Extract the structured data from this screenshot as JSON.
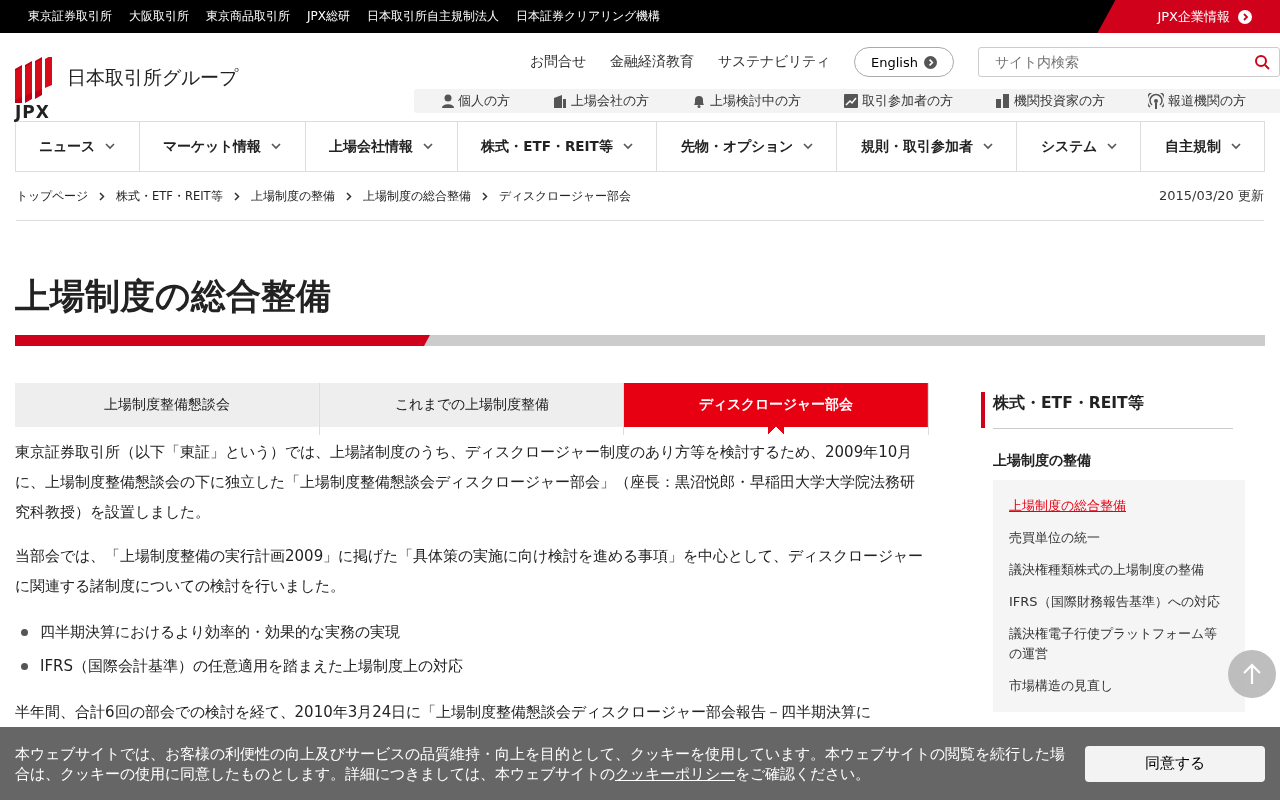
{
  "top_bar": {
    "links": [
      "東京証券取引所",
      "大阪取引所",
      "東京商品取引所",
      "JPX総研",
      "日本取引所自主規制法人",
      "日本証券クリアリング機構"
    ],
    "corporate_link": "JPX企業情報"
  },
  "header": {
    "logo_mark": "JPX",
    "logo_text": "日本取引所グループ",
    "utility_links": [
      "お問合せ",
      "金融経済教育",
      "サステナビリティ"
    ],
    "language_button": "English",
    "search": {
      "placeholder": "サイト内検索"
    },
    "audience_links": [
      {
        "kind": "person",
        "label": "個人の方"
      },
      {
        "kind": "building",
        "label": "上場会社の方"
      },
      {
        "kind": "bell",
        "label": "上場検討中の方"
      },
      {
        "kind": "chart",
        "label": "取引参加者の方"
      },
      {
        "kind": "devices",
        "label": "機関投資家の方"
      },
      {
        "kind": "broadcast",
        "label": "報道機関の方"
      }
    ]
  },
  "main_nav": [
    "ニュース",
    "マーケット情報",
    "上場会社情報",
    "株式・ETF・REIT等",
    "先物・オプション",
    "規則・取引参加者",
    "システム",
    "自主規制"
  ],
  "breadcrumb": [
    "トップページ",
    "株式・ETF・REIT等",
    "上場制度の整備",
    "上場制度の総合整備",
    "ディスクロージャー部会"
  ],
  "updated": "2015/03/20 更新",
  "page_title": "上場制度の総合整備",
  "tabs": [
    {
      "label": "上場制度整備懇談会",
      "selected": false
    },
    {
      "label": "これまでの上場制度整備",
      "selected": false
    },
    {
      "label": "ディスクロージャー部会",
      "selected": true
    }
  ],
  "content": [
    {
      "kind": "paragraph",
      "text": "東京証券取引所（以下「東証」という）では、上場諸制度のうち、ディスクロージャー制度のあり方等を検討するため、2009年10月に、上場制度整備懇談会の下に独立した「上場制度整備懇談会ディスクロージャー部会」（座長：黒沼悦郎・早稲田大学大学院法務研究科教授）を設置しました。"
    },
    {
      "kind": "paragraph",
      "text": "当部会では、「上場制度整備の実行計画2009」に掲げた「具体策の実施に向け検討を進める事項」を中心として、ディスクロージャーに関連する諸制度についての検討を行いました。"
    },
    {
      "kind": "bullets",
      "items": [
        "四半期決算におけるより効率的・効果的な実務の実現",
        "IFRS（国際会計基準）の任意適用を踏まえた上場制度上の対応"
      ]
    },
    {
      "kind": "paragraph",
      "text": "半年間、合計6回の部会での検討を経て、2010年3月24日に「上場制度整備懇談会ディスクロージャー部会報告－四半期決算に"
    }
  ],
  "sidebar": {
    "heading": "株式・ETF・REIT等",
    "section": "上場制度の整備",
    "items": [
      {
        "label": "上場制度の総合整備",
        "selected": true
      },
      {
        "label": "売買単位の統一",
        "selected": false
      },
      {
        "label": "議決権種類株式の上場制度の整備",
        "selected": false
      },
      {
        "label": "IFRS（国際財務報告基準）への対応",
        "selected": false
      },
      {
        "label": "議決権電子行使プラットフォーム等の運営",
        "selected": false
      },
      {
        "label": "市場構造の見直し",
        "selected": false
      }
    ]
  },
  "cookie_banner": {
    "text_before_link": "本ウェブサイトでは、お客様の利便性の向上及びサービスの品質維持・向上を目的として、クッキーを使用しています。本ウェブサイトの閲覧を続行した場合は、クッキーの使用に同意したものとします。詳細につきましては、本ウェブサイトの",
    "link": "クッキーポリシー",
    "text_after_link": "をご確認ください。",
    "accept_button": "同意する"
  }
}
